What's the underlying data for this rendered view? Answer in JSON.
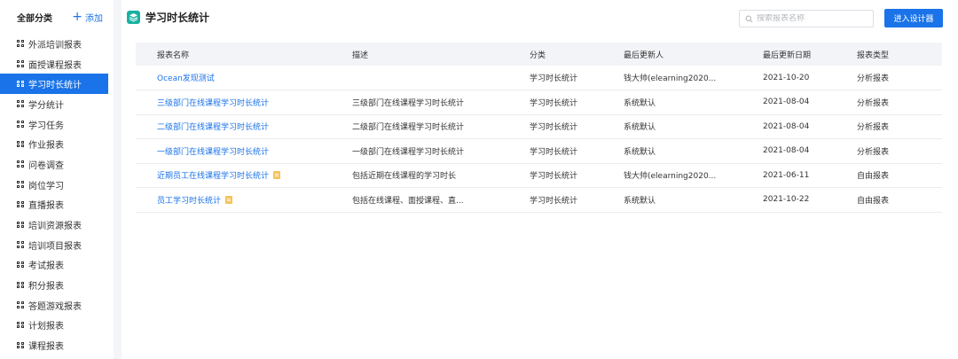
{
  "sidebar": {
    "title": "全部分类",
    "add_label": "添加",
    "items": [
      {
        "label": "外派培训报表"
      },
      {
        "label": "面授课程报表"
      },
      {
        "label": "学习时长统计"
      },
      {
        "label": "学分统计"
      },
      {
        "label": "学习任务"
      },
      {
        "label": "作业报表"
      },
      {
        "label": "问卷调查"
      },
      {
        "label": "岗位学习"
      },
      {
        "label": "直播报表"
      },
      {
        "label": "培训资源报表"
      },
      {
        "label": "培训项目报表"
      },
      {
        "label": "考试报表"
      },
      {
        "label": "积分报表"
      },
      {
        "label": "答题游戏报表"
      },
      {
        "label": "计划报表"
      },
      {
        "label": "课程报表"
      }
    ],
    "active_index": 2
  },
  "header": {
    "title": "学习时长统计",
    "search_placeholder": "搜索报表名称",
    "designer_button": "进入设计器"
  },
  "table": {
    "columns": [
      "报表名称",
      "描述",
      "分类",
      "最后更新人",
      "最后更新日期",
      "报表类型"
    ],
    "rows": [
      {
        "name": "Ocean发现测试",
        "desc": "",
        "category": "学习时长统计",
        "updater": "钱大帅(elearning2020...",
        "date": "2021-10-20",
        "type": "分析报表",
        "has_doc_icon": false
      },
      {
        "name": "三级部门在线课程学习时长统计",
        "desc": "三级部门在线课程学习时长统计",
        "category": "学习时长统计",
        "updater": "系统默认",
        "date": "2021-08-04",
        "type": "分析报表",
        "has_doc_icon": false
      },
      {
        "name": "二级部门在线课程学习时长统计",
        "desc": "二级部门在线课程学习时长统计",
        "category": "学习时长统计",
        "updater": "系统默认",
        "date": "2021-08-04",
        "type": "分析报表",
        "has_doc_icon": false
      },
      {
        "name": "一级部门在线课程学习时长统计",
        "desc": "一级部门在线课程学习时长统计",
        "category": "学习时长统计",
        "updater": "系统默认",
        "date": "2021-08-04",
        "type": "分析报表",
        "has_doc_icon": false
      },
      {
        "name": "近期员工在线课程学习时长统计",
        "desc": "包括近期在线课程的学习时长",
        "category": "学习时长统计",
        "updater": "钱大帅(elearning2020...",
        "date": "2021-06-11",
        "type": "自由报表",
        "has_doc_icon": true
      },
      {
        "name": "员工学习时长统计",
        "desc": "包括在线课程、面授课程、直...",
        "category": "学习时长统计",
        "updater": "系统默认",
        "date": "2021-10-22",
        "type": "自由报表",
        "has_doc_icon": true
      }
    ]
  },
  "colors": {
    "accent": "#1a73e8",
    "title_icon": "#18b1a0",
    "doc_icon": "#f6c35a"
  },
  "icons": {
    "sidebar_item": "grid-icon",
    "title": "layers-icon",
    "search": "search-icon",
    "row_marker": "doc-icon",
    "add": "plus-icon"
  }
}
